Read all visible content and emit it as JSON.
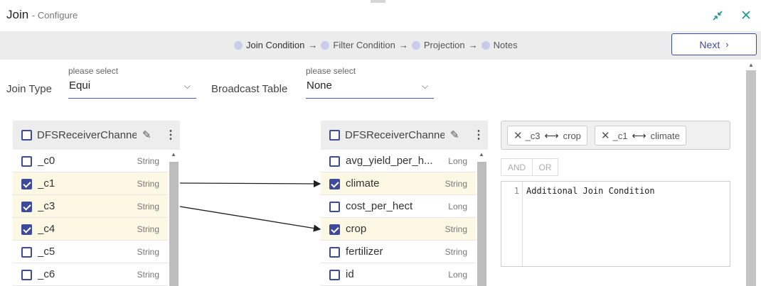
{
  "window": {
    "title": "Join",
    "subtitle": "- Configure"
  },
  "header_icons": {
    "collapse": "collapse-arrows-icon",
    "close": "close-icon"
  },
  "steps": [
    {
      "label": "Join Condition",
      "active": true
    },
    {
      "label": "Filter Condition",
      "active": false
    },
    {
      "label": "Projection",
      "active": false
    },
    {
      "label": "Notes",
      "active": false
    }
  ],
  "next_button": {
    "label": "Next"
  },
  "join_type": {
    "label": "Join Type",
    "hint": "please select",
    "value": "Equi"
  },
  "broadcast": {
    "label": "Broadcast Table",
    "hint": "please select",
    "value": "None"
  },
  "left_table": {
    "name": "DFSReceiverChannel",
    "rows": [
      {
        "name": "_c0",
        "type": "String",
        "checked": false
      },
      {
        "name": "_c1",
        "type": "String",
        "checked": true
      },
      {
        "name": "_c3",
        "type": "String",
        "checked": true
      },
      {
        "name": "_c4",
        "type": "String",
        "checked": true
      },
      {
        "name": "_c5",
        "type": "String",
        "checked": false
      },
      {
        "name": "_c6",
        "type": "String",
        "checked": false
      }
    ]
  },
  "right_table": {
    "name": "DFSReceiverChannel",
    "rows": [
      {
        "name": "avg_yield_per_hectare",
        "type": "Long",
        "checked": false
      },
      {
        "name": "climate",
        "type": "String",
        "checked": true
      },
      {
        "name": "cost_per_hect",
        "type": "Long",
        "checked": false
      },
      {
        "name": "crop",
        "type": "String",
        "checked": true
      },
      {
        "name": "fertilizer",
        "type": "String",
        "checked": false
      },
      {
        "name": "id",
        "type": "Long",
        "checked": false
      }
    ]
  },
  "join_pairs": [
    {
      "left": "_c3",
      "right": "crop"
    },
    {
      "left": "_c1",
      "right": "climate"
    }
  ],
  "logic_buttons": {
    "and": "AND",
    "or": "OR"
  },
  "editor": {
    "line_number": "1",
    "text": "Additional Join Condition"
  },
  "colors": {
    "accent": "#3e4a9c",
    "close_icon": "#1a9a8c",
    "row_selected": "#fdf8e4"
  }
}
